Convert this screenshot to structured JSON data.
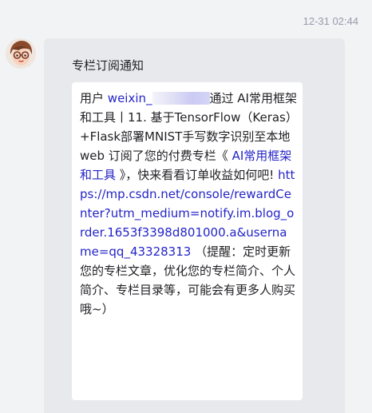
{
  "timestamp": "12-31 02:44",
  "card": {
    "title": "专栏订阅通知",
    "user_prefix": "用户",
    "user_name_visible": "weixin_",
    "via_text": "通过 AI常用框架和工具丨11. 基于TensorFlow（Keras）+Flask部署MNIST手写数字识别至本地web 订阅了您的付费专栏《",
    "column_name": " AI常用框架和工具 ",
    "after_column": "》，快来看看订单收益如何吧!",
    "link_url": "https://mp.csdn.net/console/rewardCenter?utm_medium=notify.im.blog_order.1653f3398d801000.a&username=qq_43328313",
    "tip": "（提醒：定时更新您的专栏文章，优化您的专栏简介、个人简介、专栏目录等，可能会有更多人购买哦~）"
  }
}
